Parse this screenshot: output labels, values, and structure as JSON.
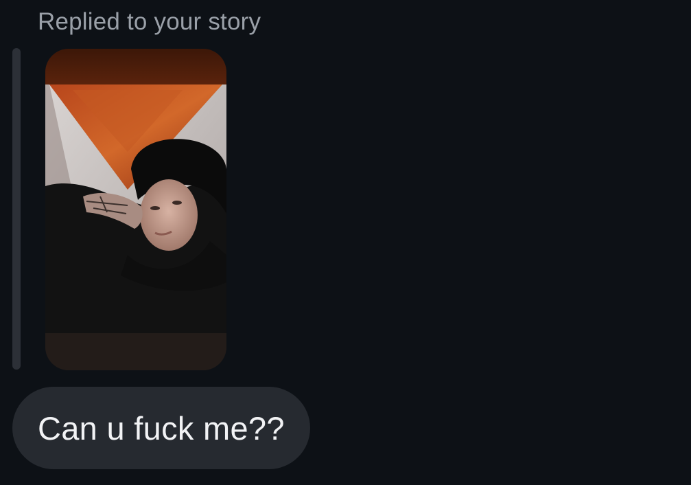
{
  "reply_context": {
    "label": "Replied to your story"
  },
  "story_preview": {
    "icon": "story-photo-thumbnail"
  },
  "message": {
    "text": "Can u fuck me??"
  },
  "colors": {
    "background": "#0d1116",
    "context_text": "#9aa0a8",
    "quote_bar": "#2c3037",
    "bubble": "#262a30",
    "message_text": "#f2f3f5"
  }
}
